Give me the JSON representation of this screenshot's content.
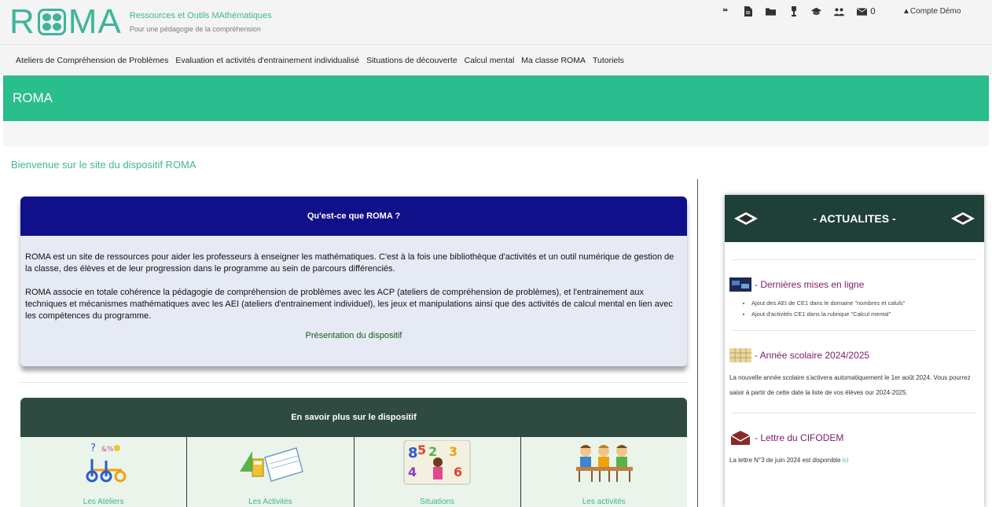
{
  "header": {
    "logo_left": "R",
    "logo_right": "MA",
    "tagline_line1": "Ressources et Outils MAthématiques",
    "tagline_line2": "Pour une pédagogie de la compréhension",
    "icons": [
      "quote-icon",
      "document-icon",
      "folder-icon",
      "trophy-icon",
      "graduation-cap-icon",
      "group-icon",
      "mail-icon"
    ],
    "mail_count": "0",
    "account_label": "Compte Démo"
  },
  "nav": {
    "items": [
      "Ateliers de Compréhension de Problèmes",
      "Evaluation et activités d'entrainement individualisé",
      "Situations de découverte",
      "Calcul mental",
      "Ma classe ROMA",
      "Tutoriels"
    ]
  },
  "banner": {
    "title": "ROMA"
  },
  "welcome": "Bienvenue sur le site du dispositif ROMA",
  "card1": {
    "title": "Qu'est-ce que ROMA ?",
    "p1": "ROMA est un site de ressources pour aider les professeurs à enseigner les mathématiques. C'est à la fois une bibliothèque d'activités et un outil numérique de gestion de la classe, des élèves et de leur progression dans le programme au sein de parcours différenciés.",
    "p2": "ROMA associe en totale cohérence la pédagogie de compréhension de problèmes avec les ACP (ateliers de compréhension de problèmes), et l'entrainement aux techniques et mécanismes mathématiques avec les AEI (ateliers d'entrainement individuel), les jeux et manipulations ainsi que des activités de calcul mental en lien avec les compétences du programme.",
    "link": "Présentation du dispositif"
  },
  "card2": {
    "title": "En savoir plus sur le dispositif",
    "tiles": [
      "Les Ateliers",
      "Les Activités",
      "Situations",
      "Les activités"
    ]
  },
  "sidebar": {
    "title": "- ACTUALITES -",
    "news1": {
      "title": "- Dernières mises en ligne",
      "items": [
        "Ajout des AEI de CE1 dans le domaine \"nombres et caluls\"",
        "Ajout d'activités CE1 dans la rubrique \"Calcul mental\""
      ]
    },
    "news2": {
      "title": "- Année scolaire 2024/2025",
      "text": "La nouvelle année scolaire s'activera automatiquement le 1er août 2024. Vous pourrez saisir à partir de cette date la liste de vos élèves our 2024-2025."
    },
    "news3": {
      "title": "- Lettre du CIFODEM",
      "text": "La lettre N°3 de juin 2024 est disponible ",
      "link": "ici"
    }
  },
  "colors": {
    "brand_green": "#3fb59a",
    "banner_green": "#2abd8e",
    "navy": "#10108a",
    "dark_teal": "#2f4a41",
    "news_purple": "#7a1b6a"
  }
}
